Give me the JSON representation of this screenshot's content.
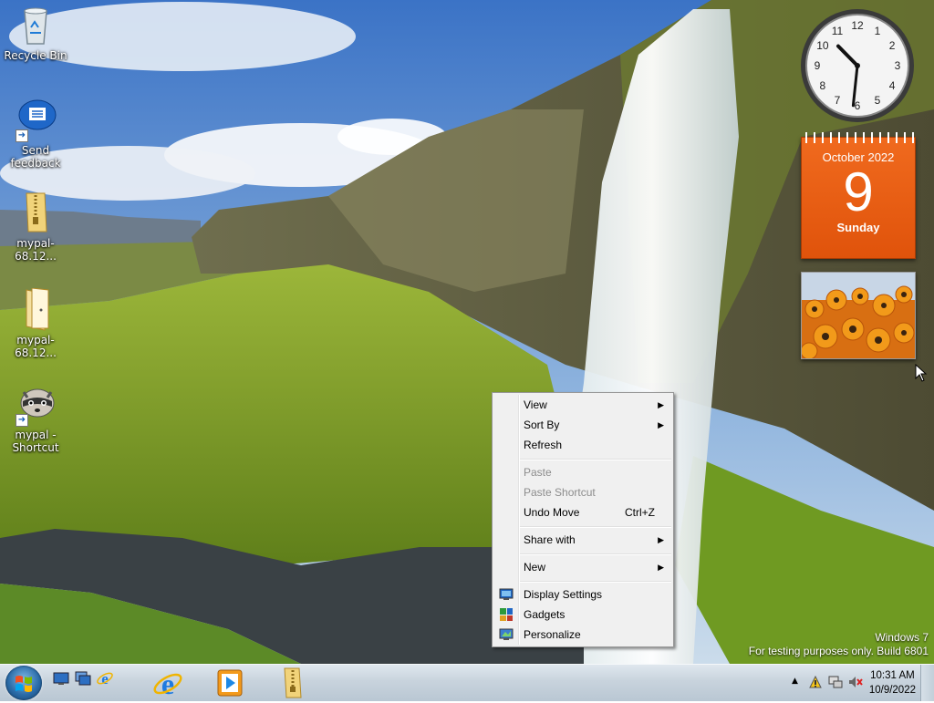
{
  "desktop": {
    "icons": [
      {
        "label": "Recycle Bin",
        "icon": "recycle-bin-icon"
      },
      {
        "label": "Send feedback",
        "icon": "feedback-icon"
      },
      {
        "label": "mypal-68.12...",
        "icon": "zip-folder-icon"
      },
      {
        "label": "mypal-68.12...",
        "icon": "folder-icon"
      },
      {
        "label": "mypal - Shortcut",
        "icon": "raccoon-icon"
      }
    ]
  },
  "gadgets": {
    "clock": {
      "hour": 10,
      "minute": 31
    },
    "calendar": {
      "month": "October 2022",
      "day": "9",
      "weekday": "Sunday"
    },
    "slideshow": {
      "subject": "orange flowers"
    }
  },
  "watermark": {
    "line1": "Windows 7",
    "line2": "For testing purposes only. Build 6801"
  },
  "context_menu": {
    "items": [
      {
        "label": "View",
        "submenu": true,
        "enabled": true
      },
      {
        "label": "Sort By",
        "submenu": true,
        "enabled": true
      },
      {
        "label": "Refresh",
        "enabled": true
      },
      {
        "label": "Paste",
        "enabled": false
      },
      {
        "label": "Paste Shortcut",
        "enabled": false
      },
      {
        "label": "Undo Move",
        "shortcut": "Ctrl+Z",
        "enabled": true
      },
      {
        "label": "Share with",
        "submenu": true,
        "enabled": true
      },
      {
        "label": "New",
        "submenu": true,
        "enabled": true
      },
      {
        "label": "Display Settings",
        "icon": "display-settings-icon",
        "enabled": true
      },
      {
        "label": "Gadgets",
        "icon": "gadgets-icon",
        "enabled": true
      },
      {
        "label": "Personalize",
        "icon": "personalize-icon",
        "enabled": true
      }
    ]
  },
  "taskbar": {
    "start": "start-orb-icon",
    "quick_launch": [
      "show-desktop-icon",
      "switch-windows-icon",
      "internet-explorer-icon"
    ],
    "pinned": [
      "internet-explorer-icon",
      "media-player-icon",
      "zip-folder-icon"
    ],
    "tray": {
      "icons": [
        "show-hidden-icons-chevron",
        "action-center-icon",
        "network-icon",
        "volume-muted-icon"
      ],
      "time": "10:31 AM",
      "date": "10/9/2022"
    }
  },
  "colors": {
    "calendar_orange": "#e85d12",
    "menu_background": "#f0f0f0",
    "taskbar": "#c8d3dd"
  }
}
